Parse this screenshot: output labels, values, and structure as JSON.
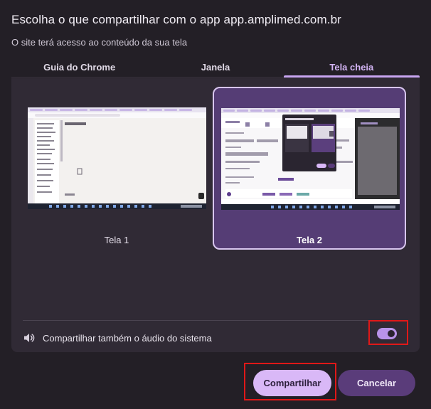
{
  "dialog": {
    "title": "Escolha o que compartilhar com o app app.amplimed.com.br",
    "subtitle": "O site terá acesso ao conteúdo da sua tela"
  },
  "tabs": [
    {
      "label": "Guia do Chrome",
      "active": false
    },
    {
      "label": "Janela",
      "active": false
    },
    {
      "label": "Tela cheia",
      "active": true
    }
  ],
  "screens": [
    {
      "label": "Tela 1",
      "selected": false
    },
    {
      "label": "Tela 2",
      "selected": true
    }
  ],
  "audio": {
    "label": "Compartilhar também o áudio do sistema",
    "enabled": true,
    "icon": "speaker-icon"
  },
  "buttons": {
    "share": "Compartilhar",
    "cancel": "Cancelar"
  },
  "colors": {
    "background": "#231f26",
    "panel": "#302a35",
    "accent": "#c9a6f2",
    "selected_card": "#553d75",
    "share_button": "#d9b8f7",
    "cancel_button": "#5a3c7a",
    "highlight": "#e01818"
  }
}
